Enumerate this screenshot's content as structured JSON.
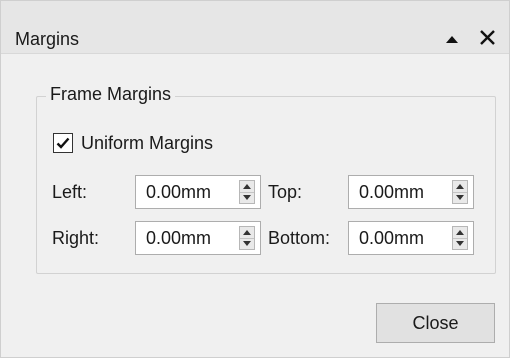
{
  "window": {
    "title": "Margins"
  },
  "group": {
    "title": "Frame Margins"
  },
  "uniform": {
    "label": "Uniform Margins",
    "checked": true
  },
  "fields": {
    "left": {
      "label": "Left:",
      "value": "0.00mm"
    },
    "top": {
      "label": "Top:",
      "value": "0.00mm"
    },
    "right": {
      "label": "Right:",
      "value": "0.00mm"
    },
    "bottom": {
      "label": "Bottom:",
      "value": "0.00mm"
    }
  },
  "buttons": {
    "close_label": "Close"
  },
  "icons": {
    "float": "triangle-up-icon",
    "close": "close-icon",
    "check": "checkmark-icon"
  }
}
